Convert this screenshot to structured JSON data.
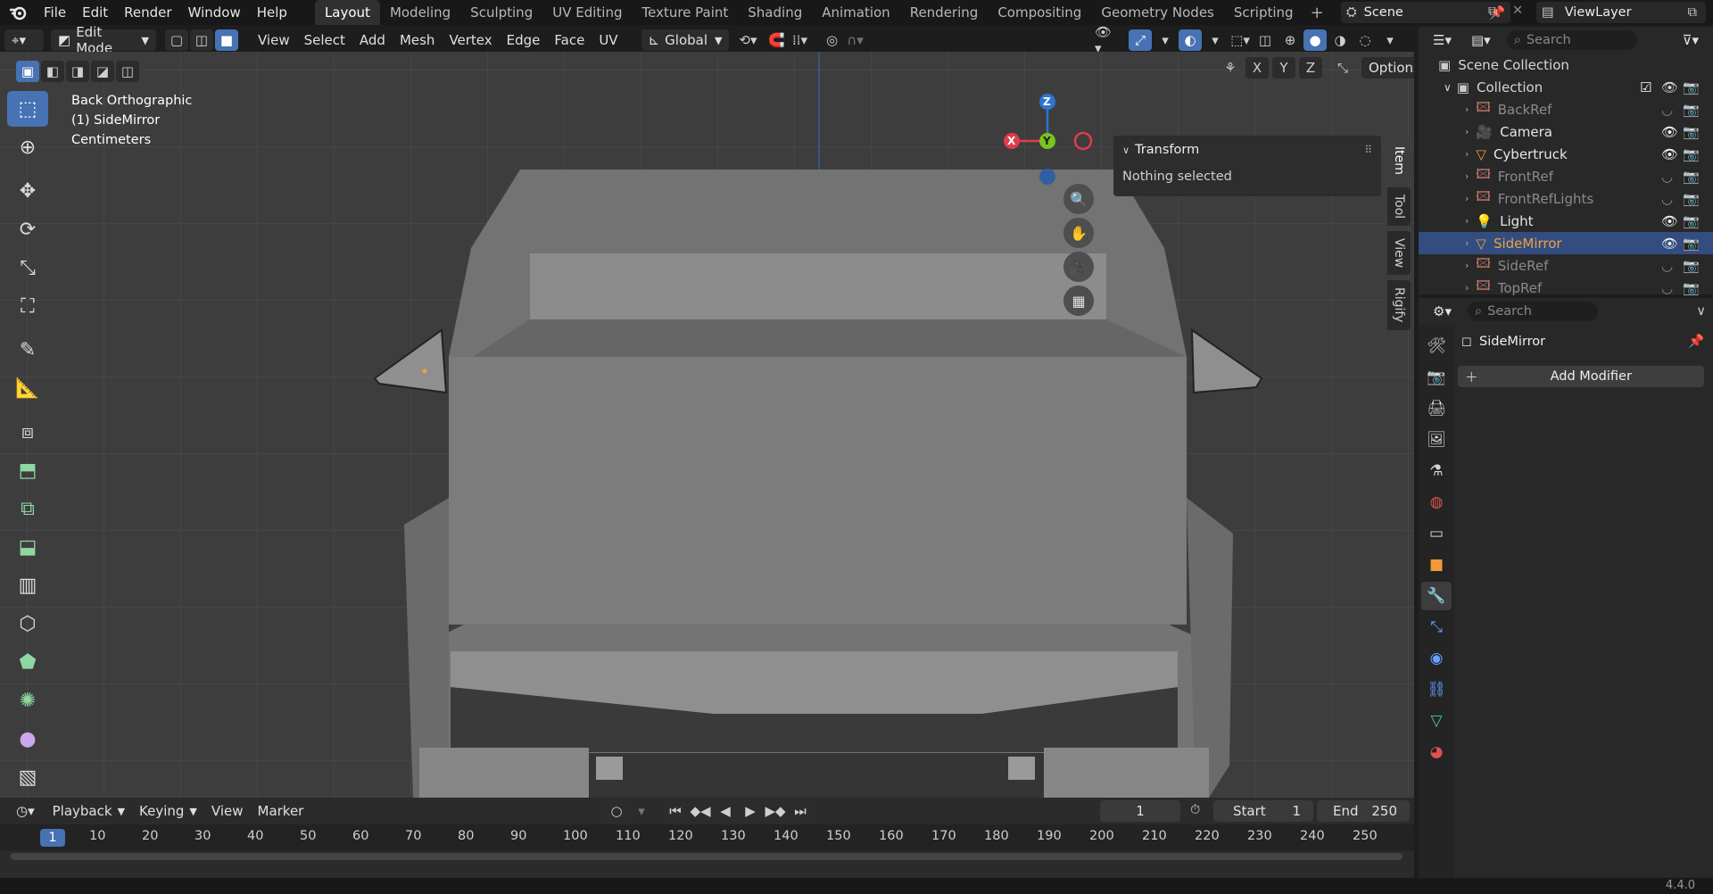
{
  "app_menu": [
    "File",
    "Edit",
    "Render",
    "Window",
    "Help"
  ],
  "workspaces": [
    "Layout",
    "Modeling",
    "Sculpting",
    "UV Editing",
    "Texture Paint",
    "Shading",
    "Animation",
    "Rendering",
    "Compositing",
    "Geometry Nodes",
    "Scripting"
  ],
  "active_workspace": "Layout",
  "scene_name": "Scene",
  "view_layer_name": "ViewLayer",
  "viewport_header": {
    "mode": "Edit Mode",
    "menus": [
      "View",
      "Select",
      "Add",
      "Mesh",
      "Vertex",
      "Edge",
      "Face",
      "UV"
    ],
    "transform_orientation": "Global",
    "options_label": "Options",
    "mirror_axes": [
      "X",
      "Y",
      "Z"
    ]
  },
  "viewport_overlay": {
    "view_name": "Back Orthographic",
    "object_line": "(1) SideMirror",
    "units": "Centimeters"
  },
  "gizmo": {
    "x_label": "X",
    "y_label": "Y",
    "z_label": "Z"
  },
  "npanel": {
    "section_title": "Transform",
    "message": "Nothing selected",
    "tabs": [
      "Item",
      "Tool",
      "View",
      "Rigify"
    ],
    "active_tab": "Item"
  },
  "timeline": {
    "menus": [
      "Playback",
      "Keying",
      "View",
      "Marker"
    ],
    "current_frame": "1",
    "start_label": "Start",
    "start_value": "1",
    "end_label": "End",
    "end_value": "250",
    "ruler_active": "1",
    "ruler_ticks": [
      "10",
      "20",
      "30",
      "40",
      "50",
      "60",
      "70",
      "80",
      "90",
      "100",
      "110",
      "120",
      "130",
      "140",
      "150",
      "160",
      "170",
      "180",
      "190",
      "200",
      "210",
      "220",
      "230",
      "240",
      "250"
    ]
  },
  "outliner": {
    "search_placeholder": "Search",
    "scene_collection": "Scene Collection",
    "collection": "Collection",
    "items": [
      {
        "name": "BackRef",
        "icon": "image-ref",
        "dim": true,
        "selected": false
      },
      {
        "name": "Camera",
        "icon": "camera",
        "dim": false,
        "selected": false
      },
      {
        "name": "Cybertruck",
        "icon": "mesh",
        "dim": false,
        "selected": false
      },
      {
        "name": "FrontRef",
        "icon": "image-ref",
        "dim": true,
        "selected": false
      },
      {
        "name": "FrontRefLights",
        "icon": "image-ref",
        "dim": true,
        "selected": false
      },
      {
        "name": "Light",
        "icon": "light",
        "dim": false,
        "selected": false
      },
      {
        "name": "SideMirror",
        "icon": "mesh",
        "dim": false,
        "selected": true
      },
      {
        "name": "SideRef",
        "icon": "image-ref",
        "dim": true,
        "selected": false
      },
      {
        "name": "TopRef",
        "icon": "image-ref",
        "dim": true,
        "selected": false
      }
    ]
  },
  "properties": {
    "search_placeholder": "Search",
    "object_name": "SideMirror",
    "add_modifier_label": "Add Modifier"
  },
  "version": "4.4.0",
  "colors": {
    "accent": "#4772b3",
    "selected_row": "#334d80",
    "active_object": "#f0a040",
    "x_axis": "#e03c4a",
    "y_axis": "#7ac41f",
    "z_axis": "#2f74d0"
  }
}
